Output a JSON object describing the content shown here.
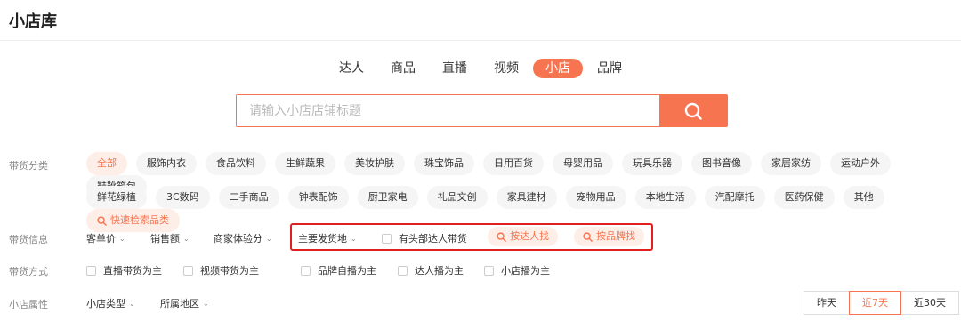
{
  "header": {
    "title": "小店库"
  },
  "tabs": [
    {
      "label": "达人"
    },
    {
      "label": "商品"
    },
    {
      "label": "直播"
    },
    {
      "label": "视频"
    },
    {
      "label": "小店"
    },
    {
      "label": "品牌"
    }
  ],
  "search": {
    "placeholder": "请输入小店店铺标题"
  },
  "category": {
    "label": "带货分类",
    "row1": [
      "全部",
      "服饰内衣",
      "食品饮料",
      "生鲜蔬果",
      "美妆护肤",
      "珠宝饰品",
      "日用百货",
      "母婴用品",
      "玩具乐器",
      "图书音像",
      "家居家纺",
      "运动户外",
      "鞋靴箱包"
    ],
    "row2": [
      "鲜花绿植",
      "3C数码",
      "二手商品",
      "钟表配饰",
      "厨卫家电",
      "礼品文创",
      "家具建材",
      "宠物用品",
      "本地生活",
      "汽配摩托",
      "医药保健",
      "其他"
    ],
    "quick": "快速检索品类"
  },
  "info": {
    "label": "带货信息",
    "price": "客单价",
    "sales": "销售额",
    "score": "商家体验分",
    "origin": "主要发货地",
    "top_talent": "有头部达人带货",
    "by_talent": "按达人找",
    "by_brand": "按品牌找"
  },
  "method": {
    "label": "带货方式",
    "options": [
      "直播带货为主",
      "视频带货为主",
      "品牌自播为主",
      "达人播为主",
      "小店播为主"
    ]
  },
  "attr": {
    "label": "小店属性",
    "type": "小店类型",
    "region": "所属地区"
  },
  "dates": [
    "昨天",
    "近7天",
    "近30天"
  ],
  "colors": {
    "accent": "#f77450",
    "highlight_box": "#e02020"
  }
}
